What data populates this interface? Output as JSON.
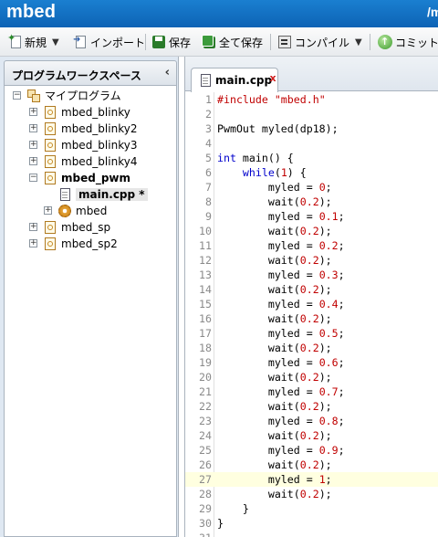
{
  "titlebar": {
    "app_title": "mbed",
    "user_link": "/m"
  },
  "toolbar": {
    "new_label": "新規",
    "import_label": "インポート",
    "save_label": "保存",
    "save_all_label": "全て保存",
    "compile_label": "コンパイル",
    "commit_label": "コミット"
  },
  "left_panel": {
    "title": "プログラムワークスペース",
    "collapse_glyph": "‹",
    "root_label": "マイプログラム",
    "items": [
      {
        "label": "mbed_blinky"
      },
      {
        "label": "mbed_blinky2"
      },
      {
        "label": "mbed_blinky3"
      },
      {
        "label": "mbed_blinky4"
      },
      {
        "label": "mbed_pwm"
      },
      {
        "label": "main.cpp *"
      },
      {
        "label": "mbed"
      },
      {
        "label": "mbed_sp"
      },
      {
        "label": "mbed_sp2"
      }
    ]
  },
  "editor": {
    "active_tab": "main.cpp",
    "tab_close": "x",
    "current_line": 27,
    "lines": [
      "#include \"mbed.h\"",
      "",
      "PwmOut myled(dp18);",
      "",
      "int main() {",
      "    while(1) {",
      "        myled = 0;",
      "        wait(0.2);",
      "        myled = 0.1;",
      "        wait(0.2);",
      "        myled = 0.2;",
      "        wait(0.2);",
      "        myled = 0.3;",
      "        wait(0.2);",
      "        myled = 0.4;",
      "        wait(0.2);",
      "        myled = 0.5;",
      "        wait(0.2);",
      "        myled = 0.6;",
      "        wait(0.2);",
      "        myled = 0.7;",
      "        wait(0.2);",
      "        myled = 0.8;",
      "        wait(0.2);",
      "        myled = 0.9;",
      "        wait(0.2);",
      "        myled = 1;",
      "        wait(0.2);",
      "    }",
      "}",
      ""
    ]
  },
  "colors": {
    "titlebar": "#0d63b5",
    "keyword": "#0000cc",
    "literal": "#c00000",
    "line_number": "#8a8a8a",
    "current_line_bg": "#ffffe0"
  }
}
